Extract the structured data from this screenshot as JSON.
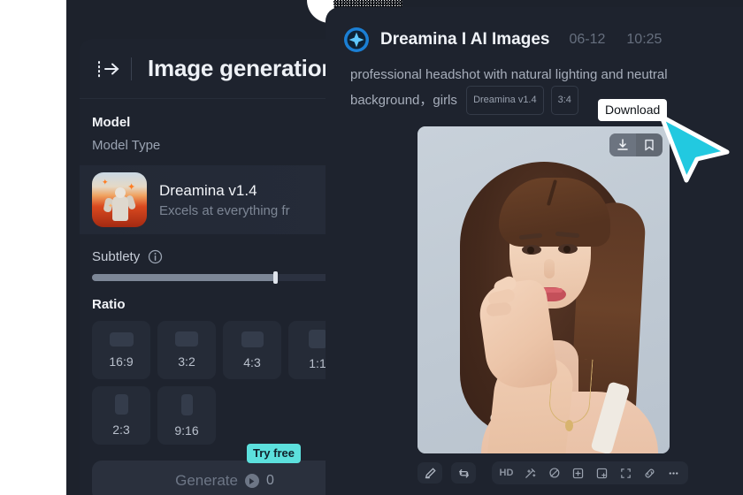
{
  "left_panel": {
    "expand_icon": "expand-sidebar-icon",
    "title": "Image generation",
    "model_section_label": "Model",
    "model_type_label": "Model Type",
    "model": {
      "name": "Dreamina  v1.4",
      "description": "Excels at everything fr",
      "thumbnail": "astronaut-in-poppy-field-thumbnail"
    },
    "subtlety": {
      "label": "Subtlety",
      "info_icon": "info-icon",
      "value_percent": 69
    },
    "ratio_section_label": "Ratio",
    "ratios": [
      {
        "label": "16:9",
        "cls": "r169"
      },
      {
        "label": "3:2",
        "cls": "r32"
      },
      {
        "label": "4:3",
        "cls": "r43"
      },
      {
        "label": "1:1",
        "cls": "r11"
      },
      {
        "label": "2:3",
        "cls": "r23"
      },
      {
        "label": "9:16",
        "cls": "r916"
      }
    ],
    "generate": {
      "label": "Generate",
      "credit_count": "0",
      "credit_icon": "credit-coin-icon",
      "badge": "Try free"
    }
  },
  "right_card": {
    "brand": "Dreamina I AI Images",
    "brand_logo": "dreamina-star-logo",
    "date": "06-12",
    "time": "10:25",
    "prompt": "professional headshot with natural lighting and neutral background，girls",
    "chips": [
      "Dreamina v1.4",
      "3:4"
    ],
    "image": {
      "alt": "ai-generated-female-portrait",
      "actions": [
        {
          "name": "download-icon",
          "active": true
        },
        {
          "name": "bookmark-icon",
          "active": false
        }
      ]
    },
    "tooltip": "Download",
    "toolbar": {
      "left_buttons": [
        "edit-pencil-icon",
        "regenerate-icon"
      ],
      "group": [
        "HD",
        "magic-wand-icon",
        "eraser-icon",
        "inpaint-frame-icon",
        "expand-frame-icon",
        "crop-icon",
        "link-icon",
        "more-dots-icon"
      ]
    }
  },
  "cursor": {
    "name": "mouse-pointer-cyan",
    "color": "#22c9e0"
  },
  "colors": {
    "panel_bg": "#1e232e",
    "canvas_bg": "#1d222c",
    "accent_cyan": "#5ce0dd",
    "brand_blue": "#1a9fff",
    "text_primary": "#f0f3f8",
    "text_muted": "#8d96a5"
  }
}
